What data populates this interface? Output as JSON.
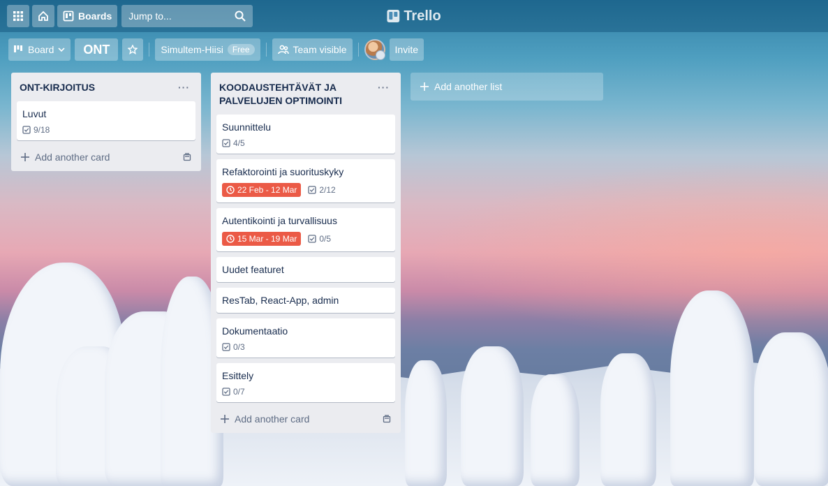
{
  "header": {
    "boards_label": "Boards",
    "search_placeholder": "Jump to...",
    "logo_text": "Trello"
  },
  "board_header": {
    "view_label": "Board",
    "board_name": "ONT",
    "team_name": "Simultem-Hiisi",
    "team_badge": "Free",
    "visibility_label": "Team visible",
    "invite_label": "Invite"
  },
  "lists": [
    {
      "title": "ONT-KIRJOITUS",
      "menu": "···",
      "cards": [
        {
          "title": "Luvut",
          "checklist": "9/18"
        }
      ],
      "add_card_label": "Add another card"
    },
    {
      "title": "KOODAUSTEHTÄVÄT JA PALVELUJEN OPTIMOINTI",
      "menu": "···",
      "cards": [
        {
          "title": "Suunnittelu",
          "checklist": "4/5"
        },
        {
          "title": "Refaktorointi ja suorituskyky",
          "due": "22 Feb - 12 Mar",
          "checklist": "2/12"
        },
        {
          "title": "Autentikointi ja turvallisuus",
          "due": "15 Mar - 19 Mar",
          "checklist": "0/5"
        },
        {
          "title": "Uudet featuret"
        },
        {
          "title": "ResTab, React-App, admin"
        },
        {
          "title": "Dokumentaatio",
          "checklist": "0/3"
        },
        {
          "title": "Esittely",
          "checklist": "0/7"
        }
      ],
      "add_card_label": "Add another card"
    }
  ],
  "add_list_label": "Add another list",
  "colors": {
    "due_badge": "#eb5a46",
    "list_bg": "#ebecf0"
  }
}
